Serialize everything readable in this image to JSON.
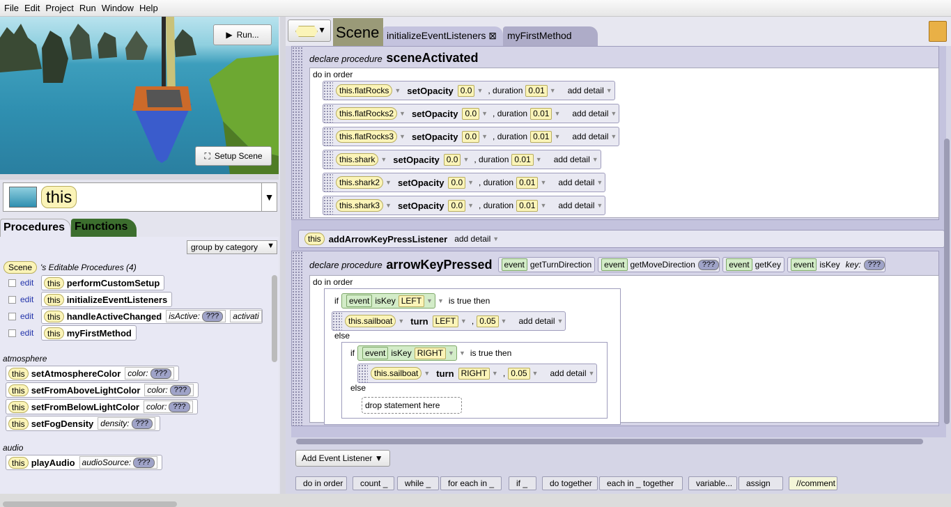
{
  "menu": [
    "File",
    "Edit",
    "Project",
    "Run",
    "Window",
    "Help"
  ],
  "scene_view": {
    "run_label": "Run...",
    "setup_label": "Setup Scene"
  },
  "selector": {
    "value": "this"
  },
  "left_tabs": {
    "procedures": "Procedures",
    "functions": "Functions"
  },
  "group_by": "group by category",
  "scene_pill": "Scene",
  "editable_title": "'s Editable Procedures (4)",
  "editable_procs": [
    {
      "edit": "edit",
      "this": "this",
      "name": "performCustomSetup"
    },
    {
      "edit": "edit",
      "this": "this",
      "name": "initializeEventListeners"
    },
    {
      "edit": "edit",
      "this": "this",
      "name": "handleActiveChanged",
      "param": "isActive:",
      "q": "???",
      "extra": "activati"
    },
    {
      "edit": "edit",
      "this": "this",
      "name": "myFirstMethod"
    }
  ],
  "categories": [
    {
      "name": "atmosphere",
      "procs": [
        {
          "this": "this",
          "name": "setAtmosphereColor",
          "param": "color:",
          "q": "???"
        },
        {
          "this": "this",
          "name": "setFromAboveLightColor",
          "param": "color:",
          "q": "???"
        },
        {
          "this": "this",
          "name": "setFromBelowLightColor",
          "param": "color:",
          "q": "???"
        },
        {
          "this": "this",
          "name": "setFogDensity",
          "param": "density:",
          "q": "???"
        }
      ]
    },
    {
      "name": "audio",
      "procs": [
        {
          "this": "this",
          "name": "playAudio",
          "param": "audioSource:",
          "q": "???"
        }
      ]
    }
  ],
  "editor_tabs": {
    "scene": "Scene",
    "tab1": "initializeEventListeners",
    "tab1_close": "⊠",
    "tab2": "myFirstMethod"
  },
  "proc1": {
    "declare": "declare procedure",
    "name": "sceneActivated",
    "do_in_order": "do in order",
    "statements": [
      {
        "obj": "this.flatRocks",
        "method": "setOpacity",
        "val": "0.0",
        "dur_label": ", duration",
        "dur": "0.01",
        "add": "add detail"
      },
      {
        "obj": "this.flatRocks2",
        "method": "setOpacity",
        "val": "0.0",
        "dur_label": ", duration",
        "dur": "0.01",
        "add": "add detail"
      },
      {
        "obj": "this.flatRocks3",
        "method": "setOpacity",
        "val": "0.0",
        "dur_label": ", duration",
        "dur": "0.01",
        "add": "add detail"
      },
      {
        "obj": "this.shark",
        "method": "setOpacity",
        "val": "0.0",
        "dur_label": ", duration",
        "dur": "0.01",
        "add": "add detail"
      },
      {
        "obj": "this.shark2",
        "method": "setOpacity",
        "val": "0.0",
        "dur_label": ", duration",
        "dur": "0.01",
        "add": "add detail"
      },
      {
        "obj": "this.shark3",
        "method": "setOpacity",
        "val": "0.0",
        "dur_label": ", duration",
        "dur": "0.01",
        "add": "add detail"
      }
    ]
  },
  "listener": {
    "this": "this",
    "name": "addArrowKeyPressListener",
    "add": "add detail"
  },
  "proc2": {
    "declare": "declare procedure",
    "name": "arrowKeyPressed",
    "params": [
      {
        "event": "event",
        "method": "getTurnDirection"
      },
      {
        "event": "event",
        "method": "getMoveDirection",
        "q": "???"
      },
      {
        "event": "event",
        "method": "getKey"
      },
      {
        "event": "event",
        "method": "isKey",
        "key": "key:",
        "q": "???"
      }
    ],
    "do_in_order": "do in order",
    "if1": {
      "if": "if",
      "event": "event",
      "method": "isKey",
      "arg": "LEFT",
      "then": "is true then"
    },
    "turn1": {
      "obj": "this.sailboat",
      "method": "turn",
      "dir": "LEFT",
      "amt": "0.05",
      "add": "add detail"
    },
    "else1": "else",
    "if2": {
      "if": "if",
      "event": "event",
      "method": "isKey",
      "arg": "RIGHT",
      "then": "is true then"
    },
    "turn2": {
      "obj": "this.sailboat",
      "method": "turn",
      "dir": "RIGHT",
      "amt": "0.05",
      "add": "add detail"
    },
    "else2": "else",
    "drop": "drop statement here"
  },
  "add_listener": "Add Event Listener ▼",
  "controls": [
    "do in order",
    "count _",
    "while _",
    "for each in _",
    "if _",
    "do together",
    "each in _ together",
    "variable...",
    "assign",
    "//comment"
  ],
  "colors": {
    "object_pill": "#fbf4b8",
    "event_pill": "#d3ecc8",
    "editor_bg": "#c4c3de",
    "functions_tab": "#3c6e2e"
  }
}
